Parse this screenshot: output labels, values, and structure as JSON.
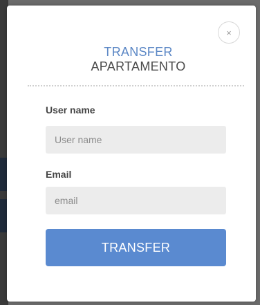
{
  "modal": {
    "title_line1": "TRANSFER",
    "title_line2": "APARTAMENTO",
    "close_icon": "×"
  },
  "form": {
    "username_label": "User name",
    "username_placeholder": "User name",
    "username_value": "",
    "email_label": "Email",
    "email_placeholder": "email",
    "email_value": "",
    "submit_label": "TRANSFER"
  },
  "colors": {
    "accent": "#5a8ad0",
    "title_accent": "#5b87c5",
    "input_bg": "#ececec"
  },
  "icons": {
    "close": "close-icon"
  }
}
